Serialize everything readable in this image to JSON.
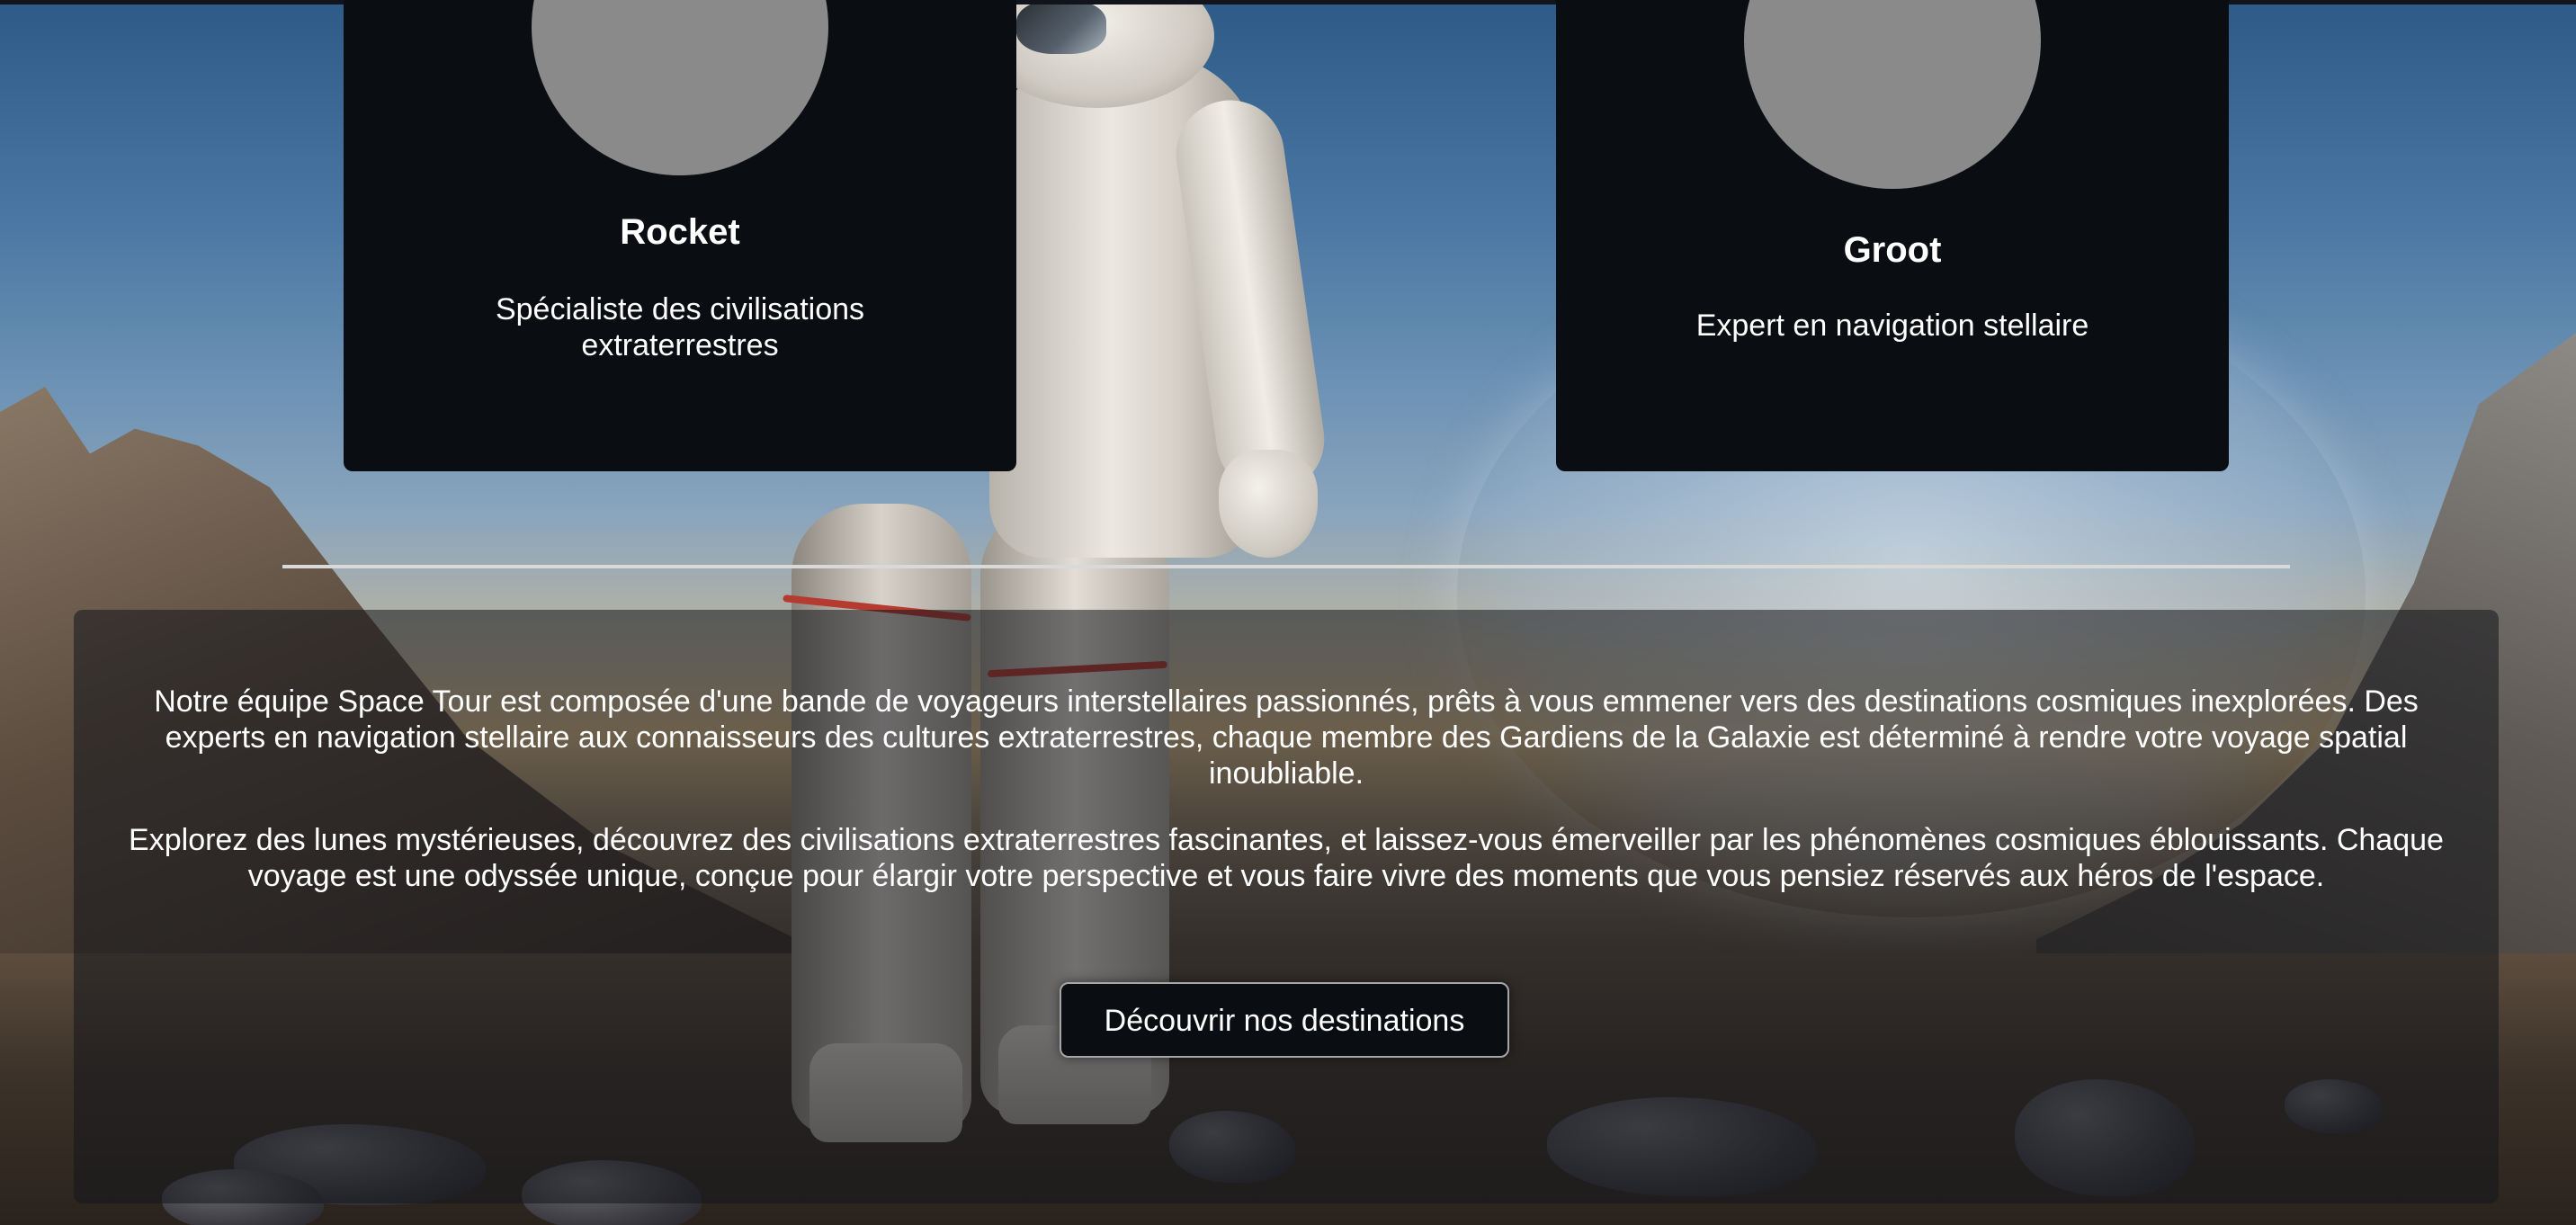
{
  "team": {
    "members": [
      {
        "name": "Rocket",
        "role": "Spécialiste des civilisations extraterrestres"
      },
      {
        "name": "Groot",
        "role": "Expert en navigation stellaire"
      }
    ]
  },
  "about": {
    "paragraph_1": "Notre équipe Space Tour est composée d'une bande de voyageurs interstellaires passionnés, prêts à vous emmener vers des destinations cosmiques inexplorées. Des experts en navigation stellaire aux connaisseurs des cultures extraterrestres, chaque membre des Gardiens de la Galaxie est déterminé à rendre votre voyage spatial inoubliable.",
    "paragraph_2": "Explorez des lunes mystérieuses, découvrez des civilisations extraterrestres fascinantes, et laissez-vous émerveiller par les phénomènes cosmiques éblouissants. Chaque voyage est une odyssée unique, conçue pour élargir votre perspective et vous faire vivre des moments que vous pensiez réservés aux héros de l'espace.",
    "cta_label": "Découvrir nos destinations"
  },
  "colors": {
    "card_background": "#0a0d12",
    "avatar_placeholder": "#8a8a8a",
    "divider": "#d9d9d9",
    "text": "#ffffff"
  }
}
